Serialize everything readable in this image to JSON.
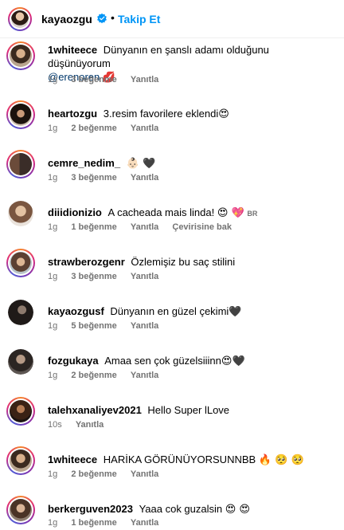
{
  "header": {
    "username": "kayaozgu",
    "separator": "•",
    "follow_label": "Takip Et"
  },
  "comments": [
    {
      "user": "1whiteece",
      "text": "Dünyanın en şanslı adamı olduğunu düşünüyorum",
      "mention": "@erenoren",
      "emoji": "💋",
      "time": "1g",
      "likes": "3 beğenme",
      "reply": "Yanıtla"
    },
    {
      "user": "heartozgu",
      "text": "3.resim favorilere eklendi",
      "emoji": "😍",
      "time": "1g",
      "likes": "2 beğenme",
      "reply": "Yanıtla"
    },
    {
      "user": "cemre_nedim_",
      "text": "",
      "emoji": "👶🏻 🖤",
      "time": "1g",
      "likes": "3 beğenme",
      "reply": "Yanıtla"
    },
    {
      "user": "diiidionizio",
      "text": "A cacheada mais linda!",
      "emoji": "😍 💖",
      "badge": "BR",
      "time": "1g",
      "likes": "1 beğenme",
      "reply": "Yanıtla",
      "translate": "Çevirisine bak"
    },
    {
      "user": "strawberozgenr",
      "text": "Özlemişiz bu saç stilini",
      "emoji": "",
      "time": "1g",
      "likes": "3 beğenme",
      "reply": "Yanıtla"
    },
    {
      "user": "kayaozgusf",
      "text": "Dünyanın en güzel çekimi",
      "emoji": "🖤",
      "time": "1g",
      "likes": "5 beğenme",
      "reply": "Yanıtla"
    },
    {
      "user": "fozgukaya",
      "text": "Amaa sen çok güzelsiiinn",
      "emoji": "😍🖤",
      "time": "1g",
      "likes": "2 beğenme",
      "reply": "Yanıtla"
    },
    {
      "user": "talehxanaliyev2021",
      "text": "Hello Super lLove",
      "emoji": "",
      "time": "10s",
      "likes": "",
      "reply": "Yanıtla"
    },
    {
      "user": "1whiteece",
      "text": "HARİKA GÖRÜNÜYORSUNNBB",
      "emoji": "🔥 🥺 🥺",
      "time": "1g",
      "likes": "2 beğenme",
      "reply": "Yanıtla"
    },
    {
      "user": "berkerguven2023",
      "text": "Yaaa cok guzalsin",
      "emoji": "😍 😍",
      "time": "1g",
      "likes": "1 beğenme",
      "reply": "Yanıtla"
    }
  ],
  "colors": {
    "accent": "#0095f6",
    "meta": "#737373",
    "mention": "#00376b"
  }
}
